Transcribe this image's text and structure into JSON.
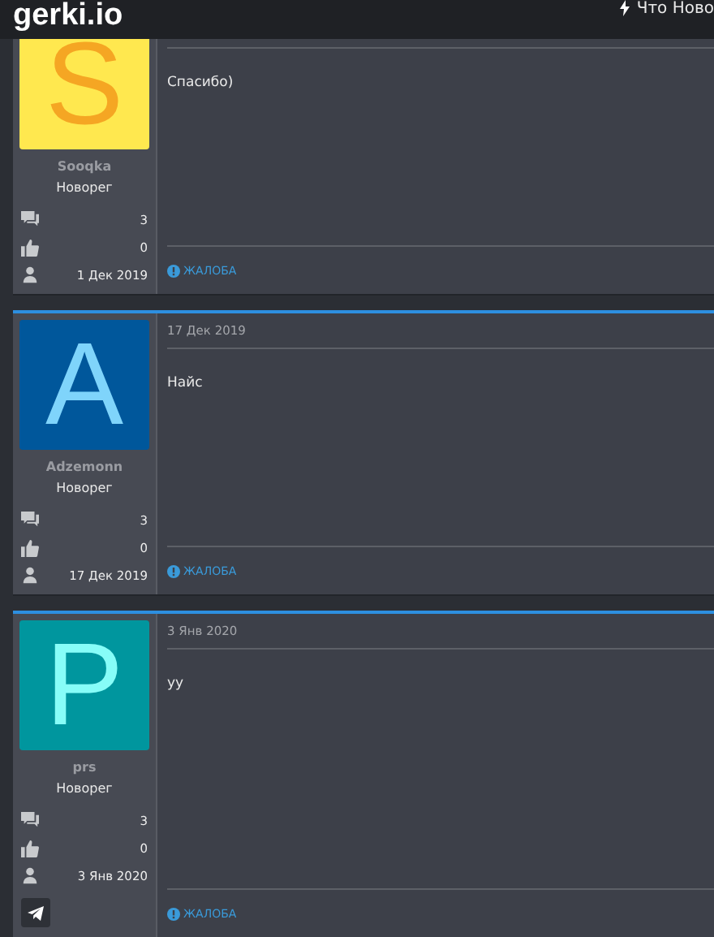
{
  "header": {
    "logo": "gerki.io",
    "nav_link": "Что Ново"
  },
  "posts": [
    {
      "highlighted": false,
      "avatar": {
        "color": "#ffe84f",
        "letter": {
          "text": "S",
          "color": "#f5a623"
        }
      },
      "username": "Sooqka",
      "role": "Новорег",
      "messages": "3",
      "likes": "0",
      "joined": "1 Дек 2019",
      "telegram": false,
      "text": "Спасибо)",
      "report": "ЖАЛОБА"
    },
    {
      "date": "17 Дек 2019",
      "highlighted": true,
      "avatar": {
        "color": "#00579b",
        "letter": {
          "text": "A",
          "color": "#7fd4fb"
        }
      },
      "username": "Adzemonn",
      "role": "Новорег",
      "messages": "3",
      "likes": "0",
      "joined": "17 Дек 2019",
      "telegram": false,
      "text": "Найс",
      "report": "ЖАЛОБА"
    },
    {
      "date": "3 Янв 2020",
      "highlighted": true,
      "avatar": {
        "color": "#00969e",
        "letter": {
          "text": "P",
          "color": "#87fdf8"
        }
      },
      "username": "prs",
      "role": "Новорег",
      "messages": "3",
      "likes": "0",
      "joined": "3 Янв 2020",
      "telegram": true,
      "text": "уу",
      "report": "ЖАЛОБА"
    }
  ]
}
